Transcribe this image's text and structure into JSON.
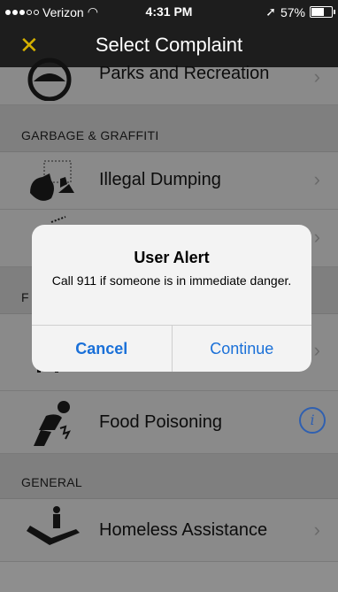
{
  "status": {
    "carrier": "Verizon",
    "time": "4:31 PM",
    "battery": "57%"
  },
  "nav": {
    "close_icon": "x-icon",
    "title": "Select Complaint"
  },
  "rows": {
    "parks": "Parks and Recreation",
    "illegal_dumping": "Illegal Dumping",
    "food_poisoning": "Food Poisoning",
    "homeless": "Homeless Assistance"
  },
  "sections": {
    "garbage": "GARBAGE & GRAFFITI",
    "food": "F",
    "general": "GENERAL"
  },
  "alert": {
    "title": "User Alert",
    "message": "Call 911 if someone is in immediate danger.",
    "cancel": "Cancel",
    "continue": "Continue"
  },
  "colors": {
    "accent_close": "#d4b000",
    "link_blue": "#1a70d8"
  }
}
